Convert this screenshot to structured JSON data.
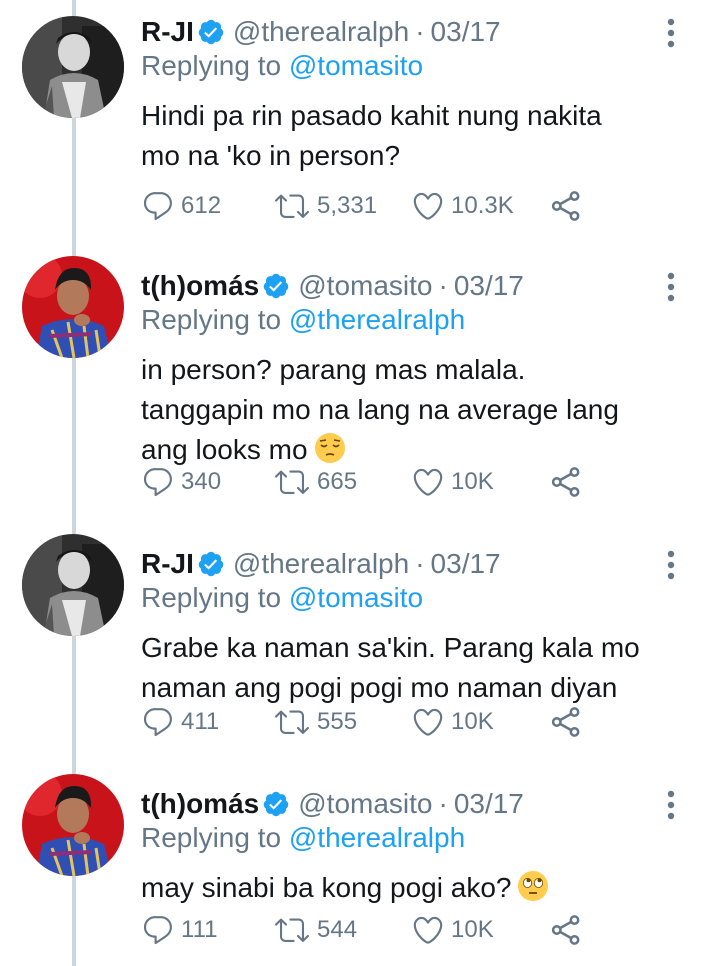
{
  "tweets": [
    {
      "avatar": "ralph-avatar",
      "name": "R-JI",
      "handle": "@therealralph",
      "date": "03/17",
      "replying_to_prefix": "Replying to ",
      "replying_to": "@tomasito",
      "text_lines": [
        "Hindi pa rin pasado kahit nung nakita",
        "mo na 'ko in person?"
      ],
      "emoji": "",
      "replies": "612",
      "retweets": "5,331",
      "likes": "10.3K"
    },
    {
      "avatar": "tomas-avatar",
      "name": "t(h)omás",
      "handle": "@tomasito",
      "date": "03/17",
      "replying_to_prefix": "Replying to ",
      "replying_to": "@therealralph",
      "text_lines": [
        "in person? parang mas malala.",
        "tanggapin mo na lang na average lang",
        "ang looks mo"
      ],
      "emoji": "pensive-face",
      "replies": "340",
      "retweets": "665",
      "likes": "10K"
    },
    {
      "avatar": "ralph-avatar",
      "name": "R-JI",
      "handle": "@therealralph",
      "date": "03/17",
      "replying_to_prefix": "Replying to ",
      "replying_to": "@tomasito",
      "text_lines": [
        "Grabe ka naman sa'kin. Parang kala mo",
        "naman ang pogi pogi mo naman diyan"
      ],
      "emoji": "",
      "replies": "411",
      "retweets": "555",
      "likes": "10K"
    },
    {
      "avatar": "tomas-avatar",
      "name": "t(h)omás",
      "handle": "@tomasito",
      "date": "03/17",
      "replying_to_prefix": "Replying to ",
      "replying_to": "@therealralph",
      "text_lines": [
        "may sinabi ba kong pogi ako?"
      ],
      "emoji": "face-with-rolling-eyes",
      "replies": "111",
      "retweets": "544",
      "likes": "10K"
    }
  ],
  "separator": "·",
  "icons": {
    "reply": "reply-icon",
    "retweet": "retweet-icon",
    "like": "heart-icon",
    "share": "share-icon",
    "verified": "verified-badge-icon",
    "more": "more-vertical-icon"
  },
  "colors": {
    "verified": "#1da1f2",
    "mention": "#1da1f2",
    "secondary_text": "#657786",
    "primary_text": "#14171a",
    "thread_line": "#ccd6dd",
    "icon": "#657786"
  }
}
